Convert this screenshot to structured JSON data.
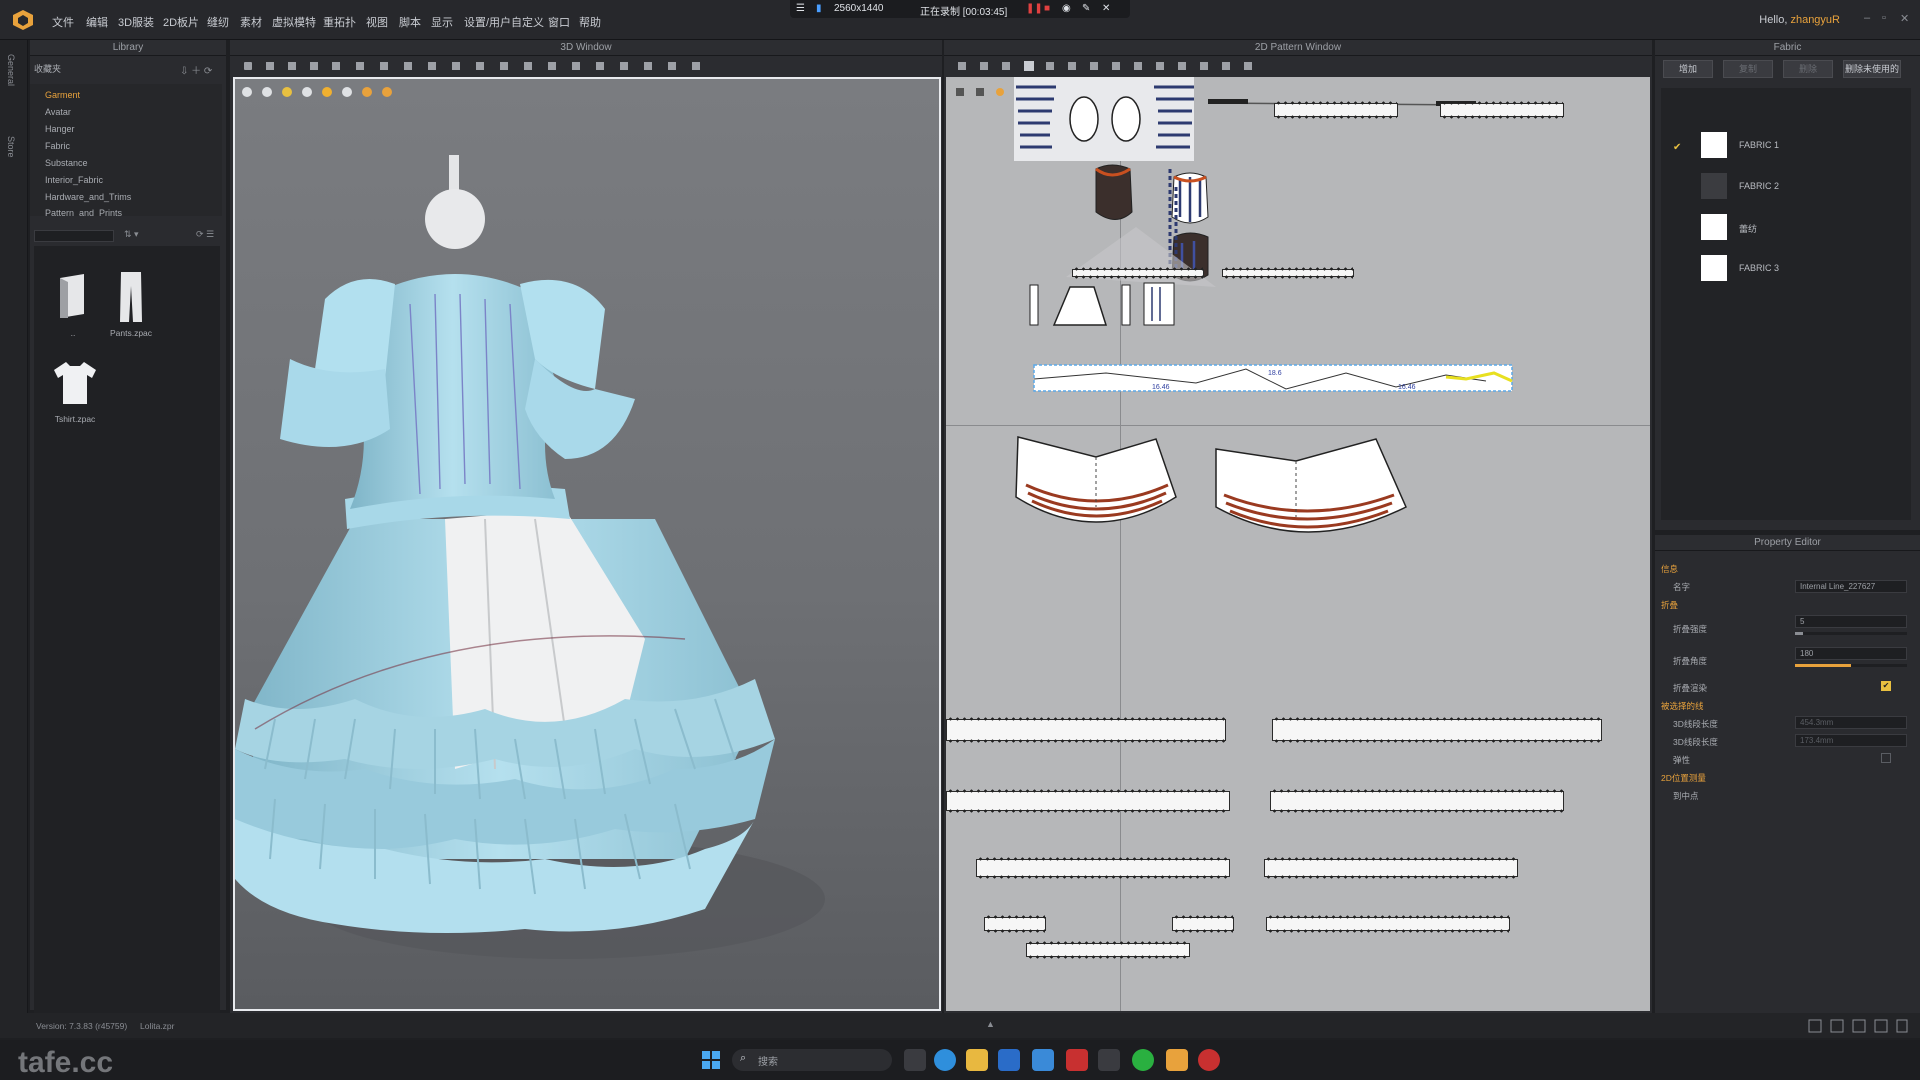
{
  "app": {
    "menu": [
      "文件",
      "编辑",
      "3D服装",
      "2D板片",
      "缝纫",
      "素材",
      "虚拟模特",
      "重拓扑",
      "视图",
      "脚本",
      "显示",
      "设置/用户自定义",
      "窗口",
      "帮助"
    ],
    "recording": {
      "resolution": "2560x1440",
      "status": "正在录制 [00:03:45]"
    },
    "greeting": "Hello,",
    "username": "zhangyuR"
  },
  "left_strip": {
    "tabs": [
      "General",
      "Store"
    ]
  },
  "library": {
    "title": "Library",
    "folder": "收藏夹",
    "items": [
      "Garment",
      "Avatar",
      "Hanger",
      "Fabric",
      "Substance",
      "Interior_Fabric",
      "Hardware_and_Trims",
      "Pattern_and_Prints"
    ],
    "selected": "Garment",
    "thumbs": [
      {
        "label": "..",
        "icon": "folder-up-icon"
      },
      {
        "label": "Pants.zpac",
        "icon": "pants-icon"
      },
      {
        "label": "Tshirt.zpac",
        "icon": "tshirt-icon"
      }
    ]
  },
  "window3d": {
    "title": "3D Window"
  },
  "window2d": {
    "title": "2D Pattern Window",
    "measure_labels": [
      "16.46",
      "16.46",
      "18.6"
    ]
  },
  "fabric_panel": {
    "title": "Fabric",
    "buttons": [
      "增加",
      "复制",
      "删除",
      "删除未使用的"
    ],
    "items": [
      {
        "name": "FABRIC 1",
        "swatch": "#ffffff",
        "checked": true
      },
      {
        "name": "FABRIC 2",
        "swatch": "#3b3c40",
        "checked": false
      },
      {
        "name": "蕾纺",
        "swatch": "#ffffff",
        "checked": false
      },
      {
        "name": "FABRIC 3",
        "swatch": "#ffffff",
        "checked": false
      }
    ]
  },
  "property_editor": {
    "title": "Property Editor",
    "sections": {
      "info": "信息",
      "fold": "折叠",
      "line_length": "被选择的线",
      "position": "2D位置测量"
    },
    "fields": {
      "name_label": "名字",
      "name_value": "Internal Line_227627",
      "fold_strength_label": "折叠强度",
      "fold_strength_value": "5",
      "fold_angle_label": "折叠角度",
      "fold_angle_value": "180",
      "fold_render_label": "折叠渲染",
      "len_3d_label": "3D线段长度",
      "len_3d_value": "454.3mm",
      "len_2d_label": "3D线段长度",
      "len_2d_value": "173.4mm",
      "follow_label": "弹性",
      "midpoint_label": "到中点"
    }
  },
  "status": {
    "version": "Version:  7.3.83 (r45759)",
    "file": "Lolita.zpr"
  },
  "taskbar": {
    "search_placeholder": "搜索"
  },
  "watermark": "tafe.cc"
}
